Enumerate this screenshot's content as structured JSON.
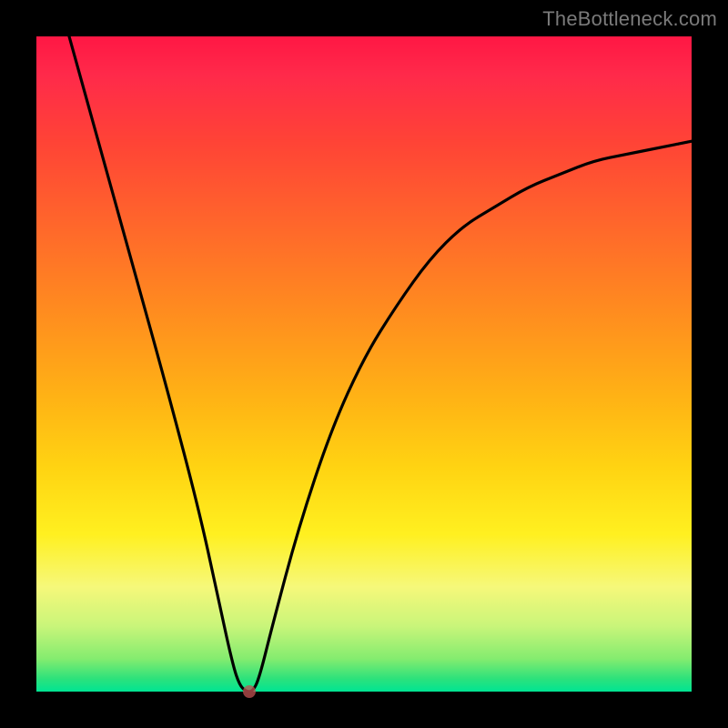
{
  "attribution": "TheBottleneck.com",
  "chart_data": {
    "type": "line",
    "title": "",
    "xlabel": "",
    "ylabel": "",
    "xlim": [
      0,
      100
    ],
    "ylim": [
      0,
      100
    ],
    "grid": false,
    "legend": false,
    "series": [
      {
        "name": "curve",
        "x": [
          5,
          10,
          15,
          20,
          25,
          28,
          30,
          31,
          32,
          33,
          34,
          36,
          40,
          45,
          50,
          55,
          60,
          65,
          70,
          75,
          80,
          85,
          90,
          95,
          100
        ],
        "y": [
          100,
          82,
          64,
          46,
          27,
          13,
          4,
          1,
          0,
          0,
          2,
          10,
          25,
          40,
          51,
          59,
          66,
          71,
          74,
          77,
          79,
          81,
          82,
          83,
          84
        ]
      }
    ],
    "min_marker": {
      "x": 32.5,
      "y": 0
    },
    "background_gradient": {
      "top": "#ff1744",
      "mid": "#ffd412",
      "bottom": "#00e493"
    }
  }
}
